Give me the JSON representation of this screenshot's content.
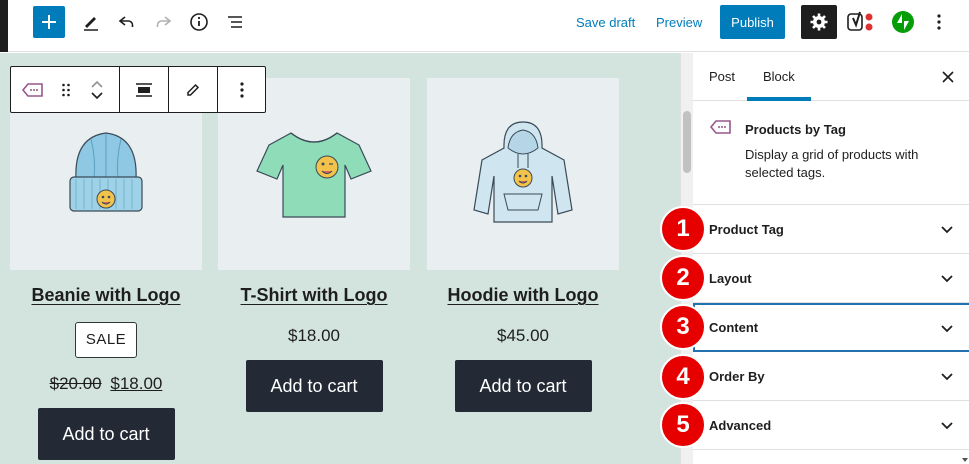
{
  "toolbar": {
    "save_draft_label": "Save draft",
    "preview_label": "Preview",
    "publish_label": "Publish",
    "icons": [
      "plus-icon",
      "pencil-icon",
      "undo-icon",
      "redo-icon",
      "info-icon",
      "list-view-icon",
      "gear-icon",
      "yoast-icon",
      "jetpack-icon",
      "more-vertical-icon"
    ]
  },
  "block_toolbar": {
    "icons": [
      "tag-block-icon",
      "drag-handle-icon",
      "move-up-icon",
      "move-down-icon",
      "align-icon",
      "edit-pencil-icon",
      "more-vertical-icon"
    ]
  },
  "products": [
    {
      "title": "Beanie with Logo",
      "badge": "SALE",
      "old_price": "$20.00",
      "price": "$18.00",
      "button": "Add to cart",
      "image": "beanie-image"
    },
    {
      "title": "T-Shirt with Logo",
      "price": "$18.00",
      "button": "Add to cart",
      "image": "tshirt-image"
    },
    {
      "title": "Hoodie with Logo",
      "price": "$45.00",
      "button": "Add to cart",
      "image": "hoodie-image"
    }
  ],
  "sidebar": {
    "tabs": [
      "Post",
      "Block"
    ],
    "active_tab": "Block",
    "block": {
      "name": "Products by Tag",
      "description": "Display a grid of products with selected tags."
    },
    "panels": [
      {
        "label": "Product Tag",
        "number": "1"
      },
      {
        "label": "Layout",
        "number": "2"
      },
      {
        "label": "Content",
        "number": "3"
      },
      {
        "label": "Order By",
        "number": "4"
      },
      {
        "label": "Advanced",
        "number": "5"
      }
    ]
  },
  "colors": {
    "accent": "#007cba",
    "canvas_bg": "#d3e4de",
    "button_dark": "#232935",
    "badge_red": "#e60000",
    "jetpack_green": "#069e08"
  }
}
